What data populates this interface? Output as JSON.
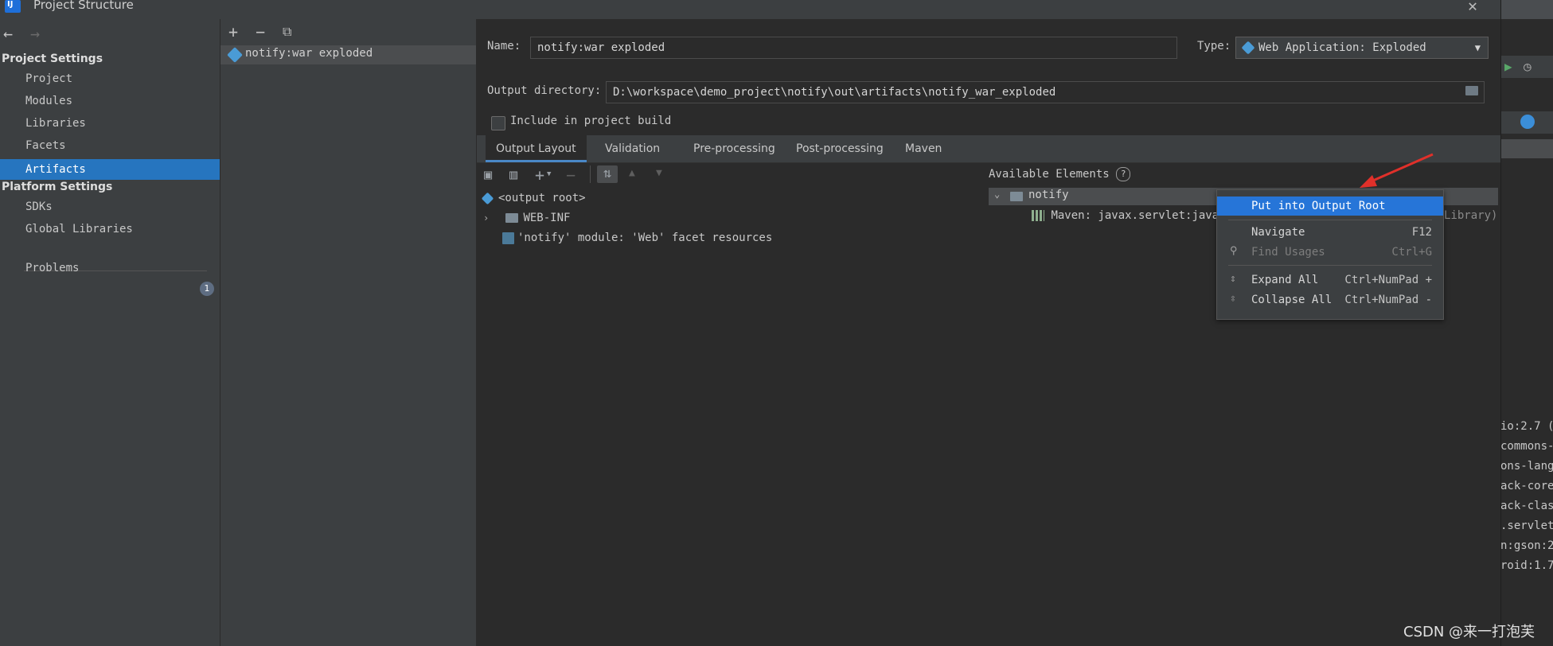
{
  "window": {
    "title": "Project Structure"
  },
  "nav": {
    "project_settings_header": "Project Settings",
    "project_items": [
      "Project",
      "Modules",
      "Libraries",
      "Facets",
      "Artifacts"
    ],
    "platform_settings_header": "Platform Settings",
    "platform_items": [
      "SDKs",
      "Global Libraries"
    ],
    "problems_label": "Problems",
    "problems_count": "1"
  },
  "artifact_list": {
    "items": [
      "notify:war exploded"
    ]
  },
  "form": {
    "name_label": "Name:",
    "name_value": "notify:war exploded",
    "type_label": "Type:",
    "type_value": "Web Application: Exploded",
    "output_dir_label": "Output directory:",
    "output_dir_value": "D:\\workspace\\demo_project\\notify\\out\\artifacts\\notify_war_exploded",
    "include_label": "Include in project build"
  },
  "tabs": [
    "Output Layout",
    "Validation",
    "Pre-processing",
    "Post-processing",
    "Maven"
  ],
  "output_tree": [
    {
      "label": "<output root>"
    },
    {
      "label": "WEB-INF"
    },
    {
      "label": "'notify' module: 'Web' facet resources"
    }
  ],
  "available": {
    "label": "Available Elements",
    "help": "?",
    "root": "notify",
    "child": "Maven: javax.servlet:javax",
    "child_tail": "Library)"
  },
  "context_menu": [
    {
      "label": "Put into Output Root",
      "shortcut": ""
    },
    {
      "label": "Navigate",
      "shortcut": "F12"
    },
    {
      "label": "Find Usages",
      "shortcut": "Ctrl+G"
    },
    {
      "label": "Expand All",
      "shortcut": "Ctrl+NumPad +"
    },
    {
      "label": "Collapse All",
      "shortcut": "Ctrl+NumPad -"
    }
  ],
  "background_lines": [
    "io:2.7 (",
    "commons-",
    "ons-lang3",
    "ack-core",
    "ack-clas",
    ".servlet",
    "n:gson:2",
    "roid:1.7"
  ],
  "watermark": "CSDN @来一打泡芙",
  "colors": {
    "selection": "#2675bf",
    "menu_selection": "#2675d8",
    "arrow": "#e0302a"
  }
}
